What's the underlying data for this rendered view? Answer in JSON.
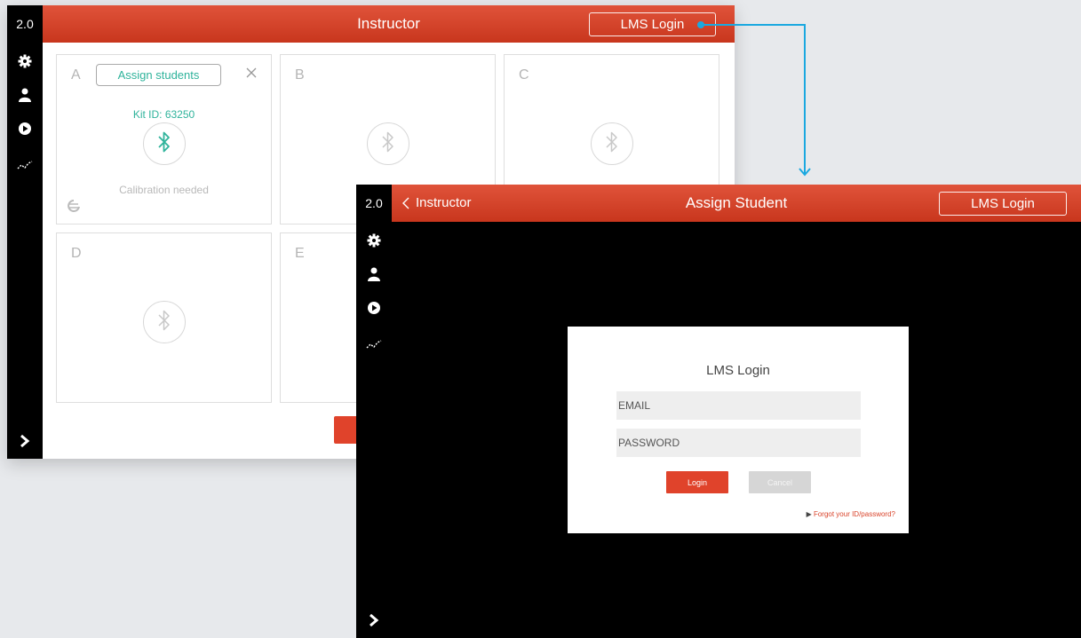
{
  "colors": {
    "accent": "#d44a2f",
    "teal": "#2fb39b",
    "connector": "#1aa8e0"
  },
  "screen1": {
    "version": "2.0",
    "title": "Instructor",
    "lms_button": "LMS Login",
    "sidebar_icons": [
      "gear-icon",
      "user-icon",
      "play-icon",
      "chart-icon",
      "chevron-right-icon"
    ],
    "cards": [
      {
        "letter": "A",
        "assign_label": "Assign students",
        "kit_id": "Kit ID: 63250",
        "status": "Calibration needed"
      },
      {
        "letter": "B"
      },
      {
        "letter": "C"
      },
      {
        "letter": "D"
      },
      {
        "letter": "E"
      }
    ]
  },
  "screen2": {
    "version": "2.0",
    "back_label": "Instructor",
    "title": "Assign Student",
    "lms_button": "LMS Login",
    "dialog": {
      "title": "LMS Login",
      "email_placeholder": "EMAIL",
      "password_placeholder": "PASSWORD",
      "login_button": "Login",
      "cancel_button": "Cancel",
      "forgot_link": "Forgot your ID/password?"
    }
  }
}
